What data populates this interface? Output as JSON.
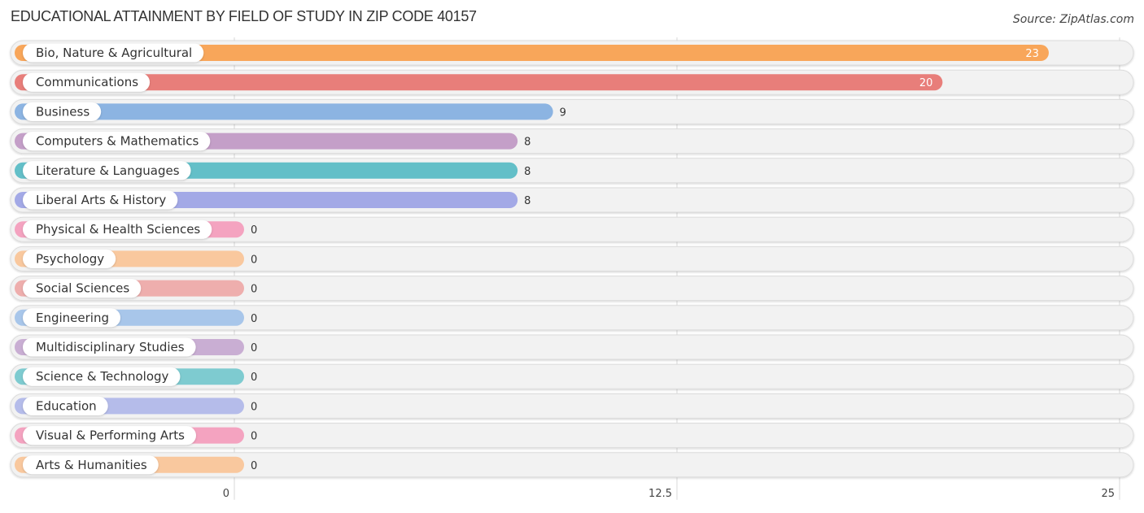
{
  "header": {
    "title": "EDUCATIONAL ATTAINMENT BY FIELD OF STUDY IN ZIP CODE 40157",
    "source": "Source: ZipAtlas.com"
  },
  "chart_data": {
    "type": "bar",
    "orientation": "horizontal",
    "title": "EDUCATIONAL ATTAINMENT BY FIELD OF STUDY IN ZIP CODE 40157",
    "xlabel": "",
    "ylabel": "",
    "xlim": [
      0,
      25
    ],
    "xticks": [
      0,
      12.5,
      25
    ],
    "xtick_labels": [
      "0",
      "12.5",
      "25"
    ],
    "grid": true,
    "categories": [
      "Bio, Nature & Agricultural",
      "Communications",
      "Business",
      "Computers & Mathematics",
      "Literature & Languages",
      "Liberal Arts & History",
      "Physical & Health Sciences",
      "Psychology",
      "Social Sciences",
      "Engineering",
      "Multidisciplinary Studies",
      "Science & Technology",
      "Education",
      "Visual & Performing Arts",
      "Arts & Humanities"
    ],
    "values": [
      23,
      20,
      9,
      8,
      8,
      8,
      0,
      0,
      0,
      0,
      0,
      0,
      0,
      0,
      0
    ],
    "value_labels": [
      "23",
      "20",
      "9",
      "8",
      "8",
      "8",
      "0",
      "0",
      "0",
      "0",
      "0",
      "0",
      "0",
      "0",
      "0"
    ],
    "colors": [
      "#f8a65a",
      "#e87e7a",
      "#8cb4e2",
      "#c49fc8",
      "#63bfc8",
      "#a3a9e6",
      "#f4a3c0",
      "#f9c89e",
      "#eeaead",
      "#a8c6ea",
      "#c9aed3",
      "#7ecbd0",
      "#b5bcea",
      "#f4a3c0",
      "#f9c89e"
    ]
  }
}
